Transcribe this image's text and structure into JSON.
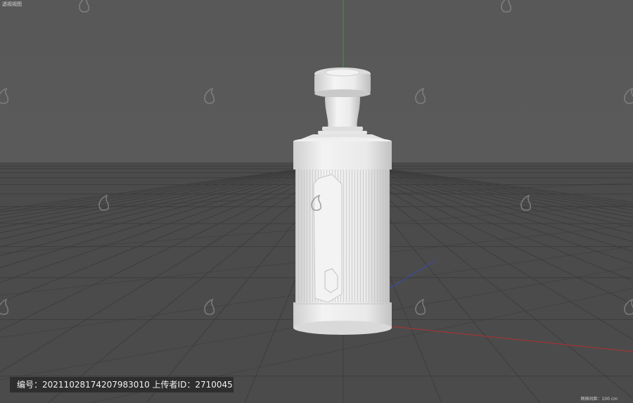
{
  "viewport": {
    "label": "透视视图",
    "grid_info": "网格间距：100 cm"
  },
  "watermark": {
    "banner_label": "编号：",
    "asset_number": "20211028174207983010",
    "uploader_label": "上传者ID：",
    "uploader_id": "2710045"
  },
  "colors": {
    "background": "#5a5a5a",
    "floor": "#4a4a4a",
    "grid_line": "#3c3c3c",
    "model": "#e8e8e8",
    "axis_x": "#b03030",
    "axis_y": "#3a9a3a",
    "axis_z": "#3a4ab0"
  }
}
